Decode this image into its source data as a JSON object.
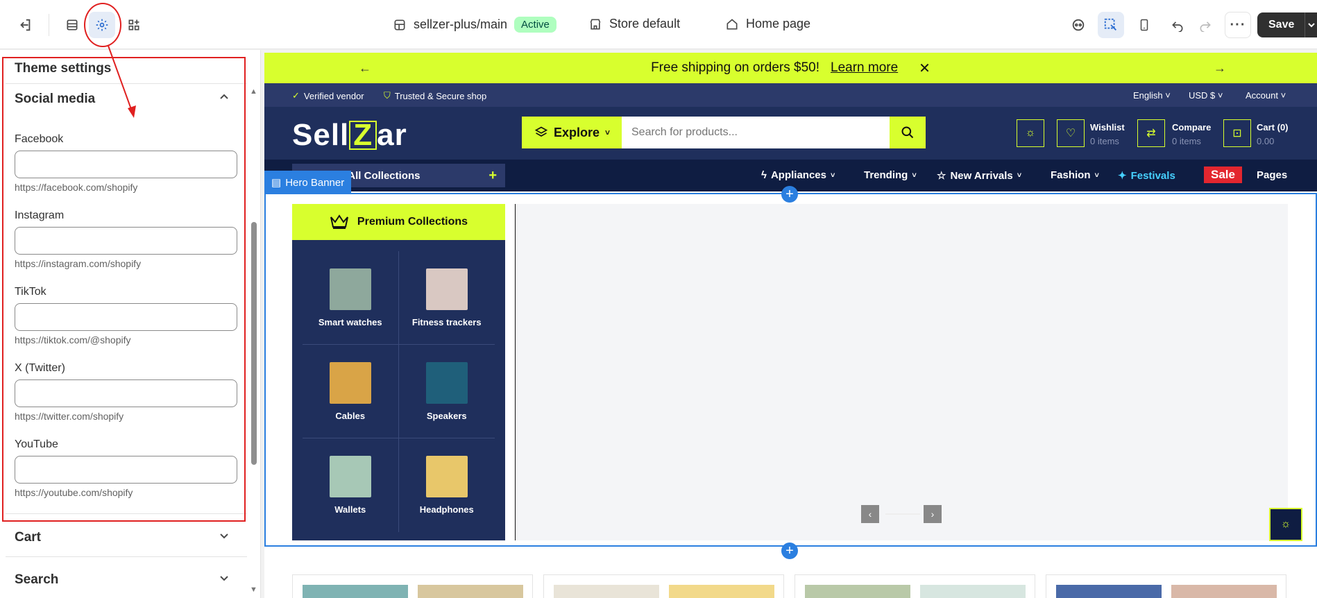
{
  "topbar": {
    "theme_name": "sellzer-plus/main",
    "status": "Active",
    "store": "Store default",
    "page": "Home page",
    "save_label": "Save"
  },
  "sidebar": {
    "title": "Theme settings",
    "section": "Social media",
    "fields": [
      {
        "label": "Facebook",
        "help": "https://facebook.com/shopify",
        "value": ""
      },
      {
        "label": "Instagram",
        "help": "https://instagram.com/shopify",
        "value": ""
      },
      {
        "label": "TikTok",
        "help": "https://tiktok.com/@shopify",
        "value": ""
      },
      {
        "label": "X (Twitter)",
        "help": "https://twitter.com/shopify",
        "value": ""
      },
      {
        "label": "YouTube",
        "help": "https://youtube.com/shopify",
        "value": ""
      }
    ],
    "collapsed": [
      "Cart",
      "Search"
    ]
  },
  "store": {
    "announcement": "Free shipping on orders $50!",
    "announcement_link": "Learn more",
    "badges": [
      "Verified vendor",
      "Trusted & Secure shop"
    ],
    "language": "English",
    "currency": "USD $",
    "account": "Account",
    "explore": "Explore",
    "search_placeholder": "Search for products...",
    "wishlist": {
      "label": "Wishlist",
      "sub": "0 items"
    },
    "compare": {
      "label": "Compare",
      "sub": "0 items"
    },
    "cart": {
      "label": "Cart (0)",
      "sub": "0.00"
    },
    "browse": "Browse All Collections",
    "browse_visible": "se All Collections",
    "hero_tag": "Hero Banner",
    "nav": [
      "Appliances",
      "Trending",
      "New Arrivals",
      "Fashion",
      "Festivals",
      "Sale",
      "Pages"
    ],
    "premium": "Premium Collections",
    "collections": [
      {
        "label": "Smart watches",
        "color": "#8ea89c"
      },
      {
        "label": "Fitness trackers",
        "color": "#d9c8c2"
      },
      {
        "label": "Cables",
        "color": "#d9a447"
      },
      {
        "label": "Speakers",
        "color": "#1f5f7a"
      },
      {
        "label": "Wallets",
        "color": "#a7c8b6"
      },
      {
        "label": "Headphones",
        "color": "#e8c76a"
      }
    ]
  },
  "colors": {
    "accent": "#d8ff2e",
    "navy": "#1f2f5c",
    "selection": "#2b7fe0",
    "annotation": "#e02020"
  }
}
